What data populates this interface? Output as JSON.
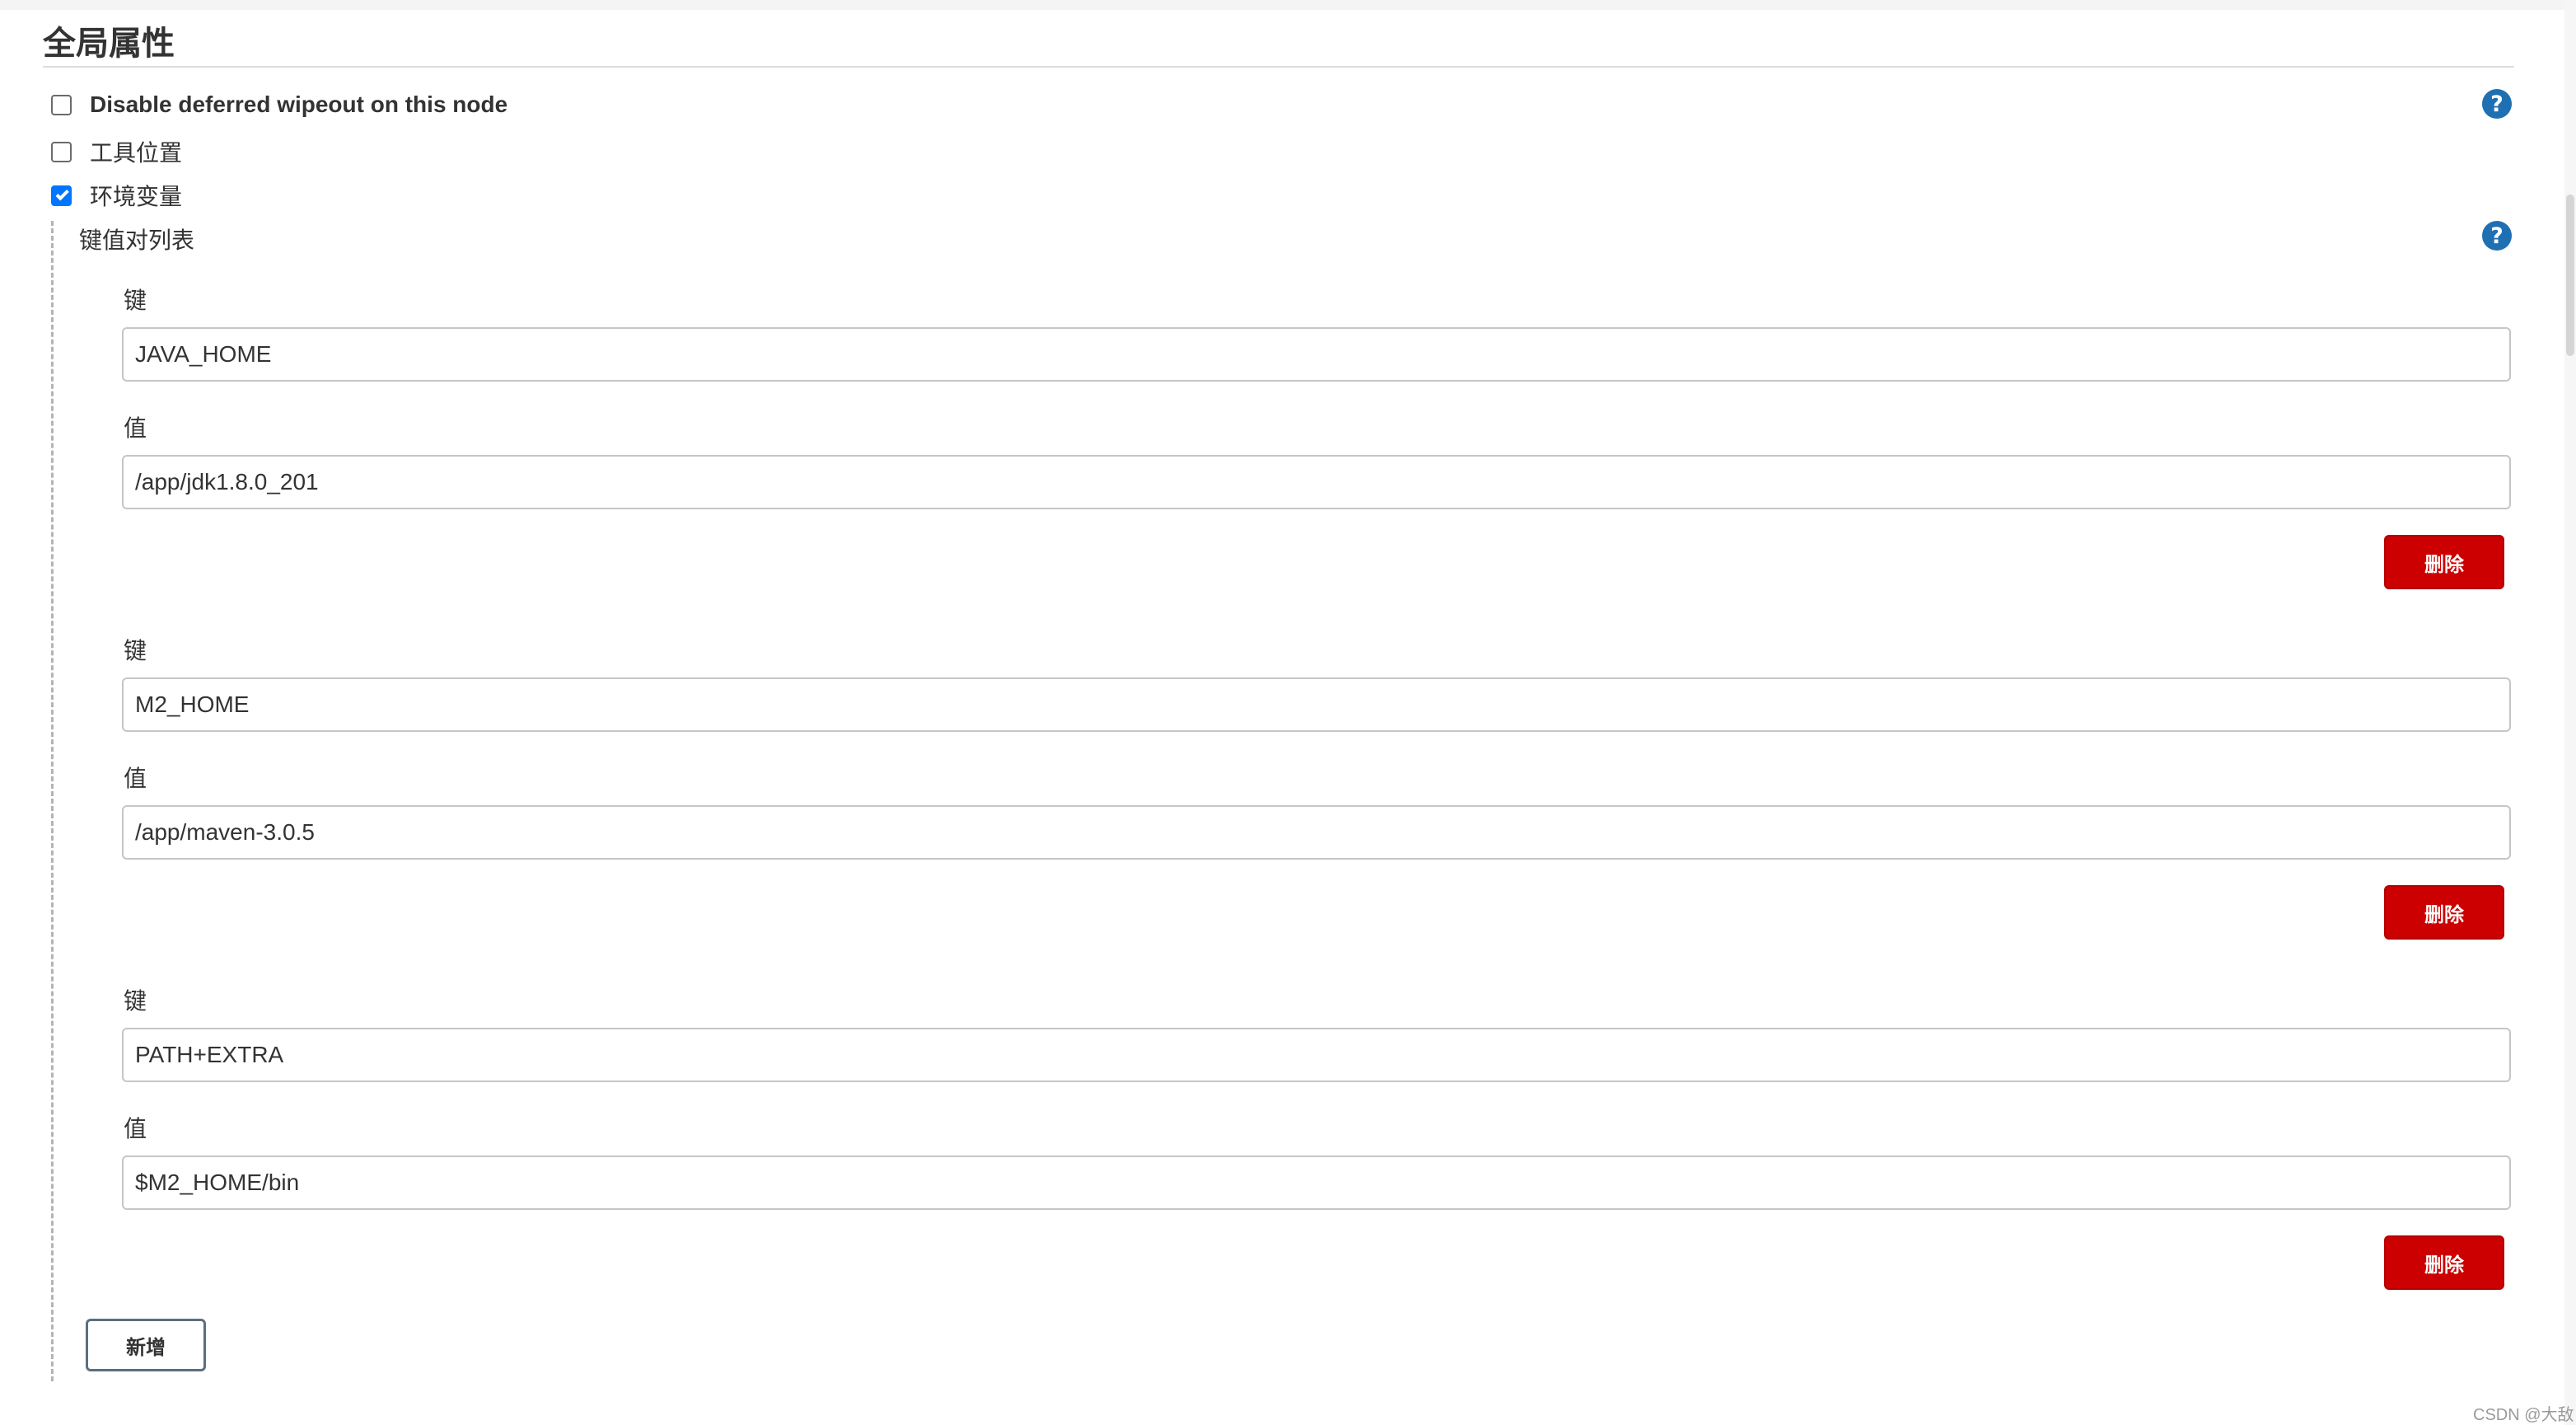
{
  "section": {
    "title": "全局属性"
  },
  "options": {
    "disable_wipeout": {
      "label": "Disable deferred wipeout on this node",
      "checked": false
    },
    "tool_locations": {
      "label": "工具位置",
      "checked": false
    },
    "env_vars": {
      "label": "环境变量",
      "checked": true
    }
  },
  "help_icon": {
    "glyph": "?"
  },
  "kv": {
    "title": "键值对列表",
    "key_label": "键",
    "value_label": "值",
    "delete_label": "删除",
    "add_label": "新增",
    "entries": [
      {
        "key": "JAVA_HOME",
        "value": "/app/jdk1.8.0_201"
      },
      {
        "key": "M2_HOME",
        "value": "/app/maven-3.0.5"
      },
      {
        "key": "PATH+EXTRA",
        "value": "$M2_HOME/bin"
      }
    ]
  },
  "watermark": "CSDN @大敌",
  "colors": {
    "delete_button": "#cc0000",
    "help_icon": "#1f6fb3",
    "checkbox_checked": "#0075ff"
  }
}
